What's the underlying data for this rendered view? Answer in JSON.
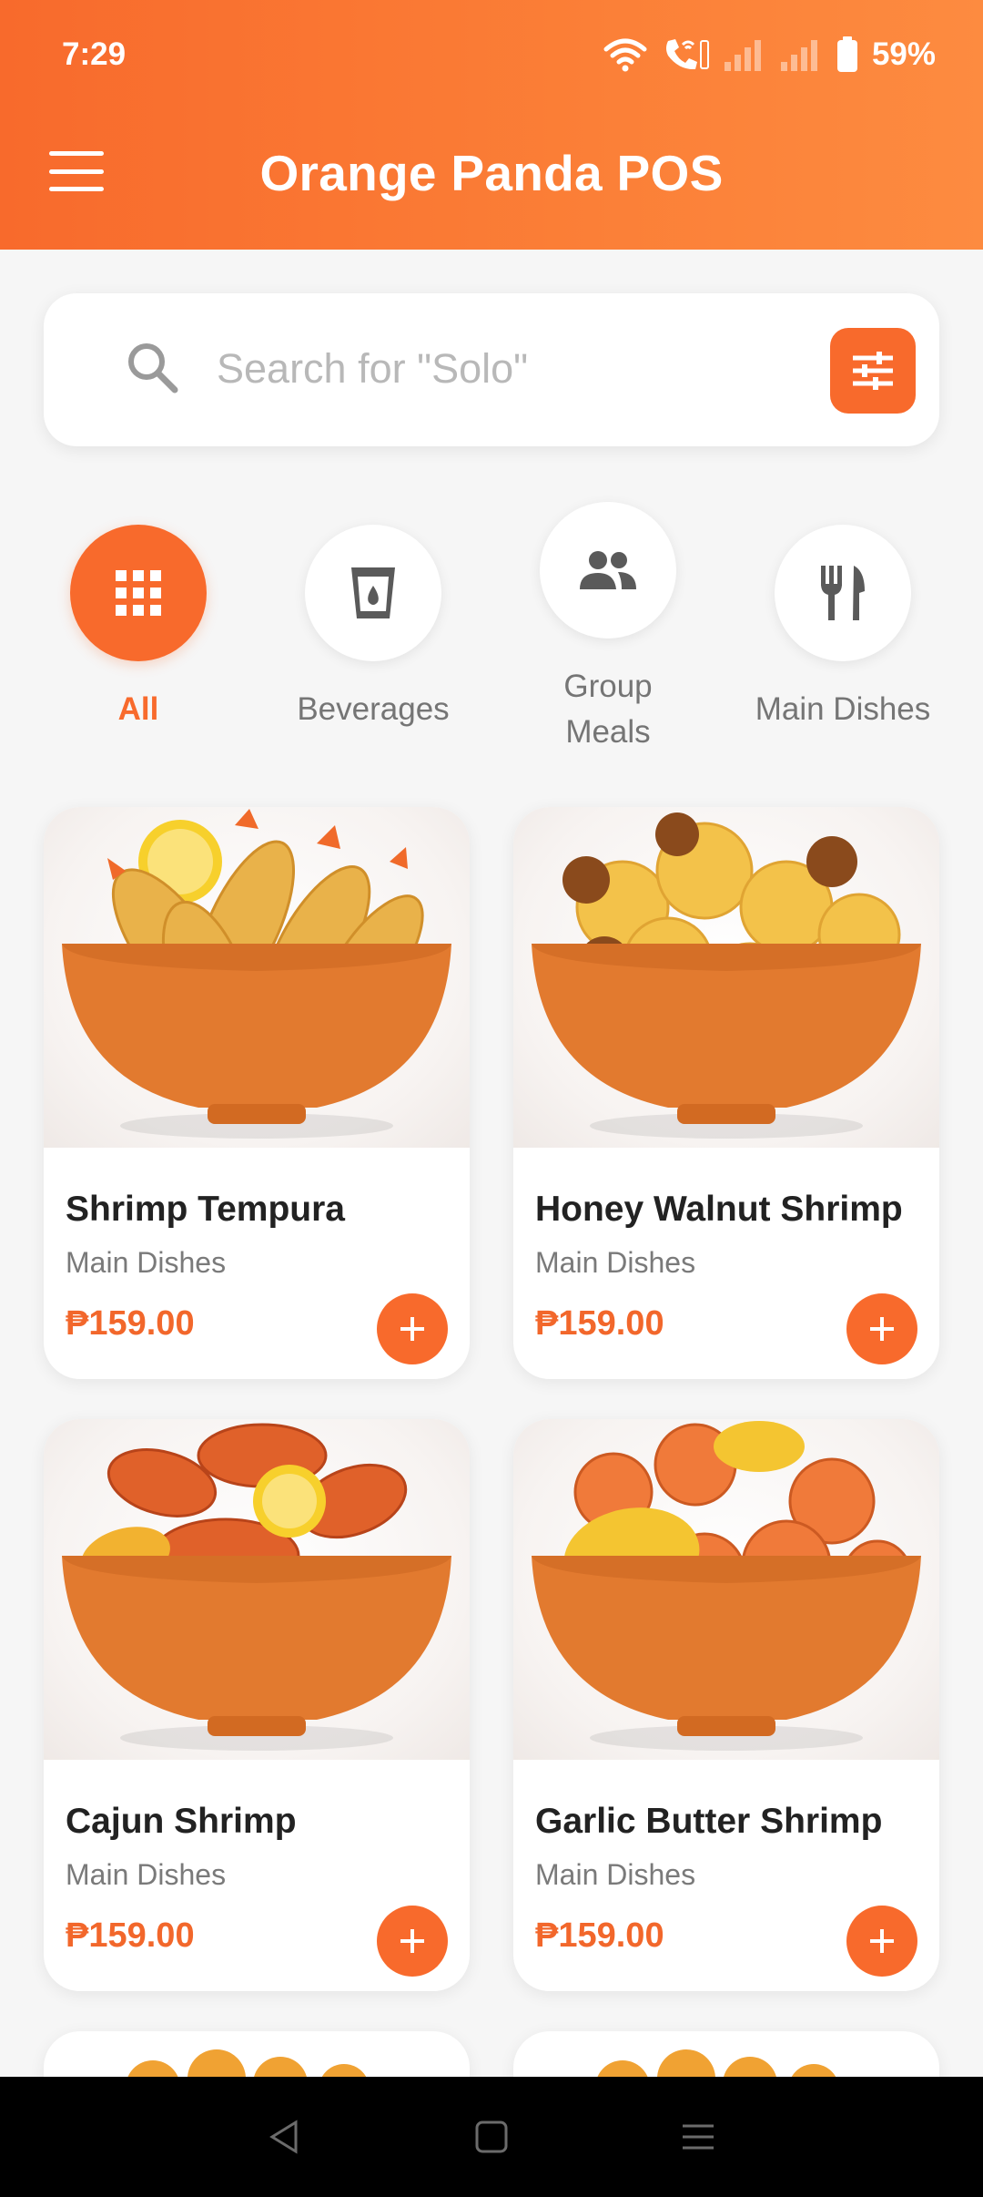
{
  "status": {
    "time": "7:29",
    "battery": "59%",
    "icons": [
      "wifi-icon",
      "wifi-calling-icon",
      "signal-icon",
      "signal-icon",
      "battery-icon"
    ]
  },
  "header": {
    "title": "Orange Panda POS",
    "menu_icon": "hamburger-menu-icon"
  },
  "search": {
    "placeholder": "Search for \"Solo\"",
    "icon": "search-icon",
    "filter_icon": "filter-sliders-icon"
  },
  "categories": [
    {
      "label": "All",
      "icon": "grid-icon",
      "active": true
    },
    {
      "label": "Beverages",
      "icon": "cup-icon",
      "active": false
    },
    {
      "label": "Group\nMeals",
      "icon": "group-people-icon",
      "active": false
    },
    {
      "label": "Main Dishes",
      "icon": "fork-knife-icon",
      "active": false
    }
  ],
  "products": [
    {
      "name": "Shrimp Tempura",
      "category": "Main Dishes",
      "price": "₱159.00"
    },
    {
      "name": "Honey Walnut Shrimp",
      "category": "Main Dishes",
      "price": "₱159.00"
    },
    {
      "name": "Cajun Shrimp",
      "category": "Main Dishes",
      "price": "₱159.00"
    },
    {
      "name": "Garlic Butter Shrimp",
      "category": "Main Dishes",
      "price": "₱159.00"
    }
  ],
  "colors": {
    "brand": "#f86a2c",
    "price": "#f2672b",
    "bowl": "#e07a2e"
  },
  "navbar": {
    "icons": [
      "back-icon",
      "home-icon",
      "recents-icon"
    ]
  }
}
